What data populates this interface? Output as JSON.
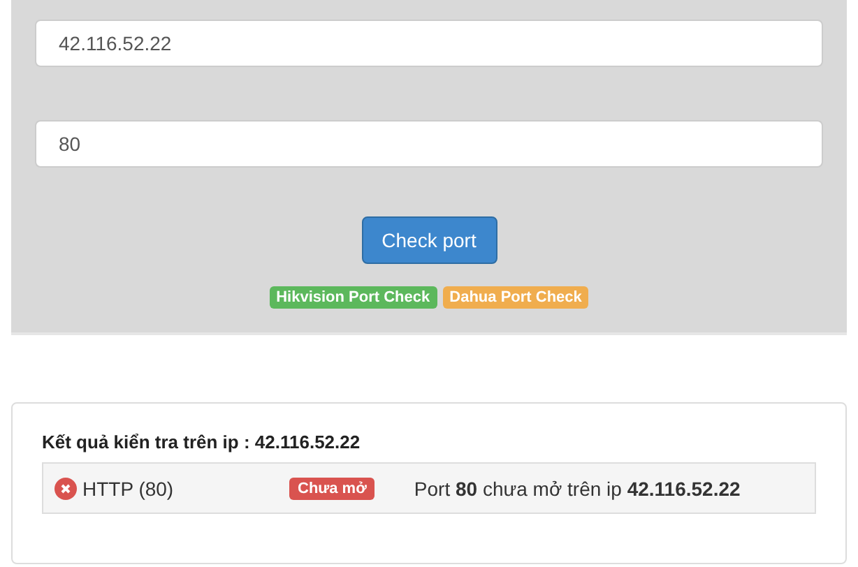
{
  "form": {
    "ip_field": {
      "value": "42.116.52.22"
    },
    "port_field": {
      "value": "80"
    },
    "submit": "Check port",
    "links": [
      {
        "label": "Hikvision Port Check",
        "color": "#5cb85c"
      },
      {
        "label": "Dahua Port Check",
        "color": "#f0ad4e"
      }
    ]
  },
  "result": {
    "title": "Kết quả kiển tra trên ip : 42.116.52.22",
    "rows": [
      {
        "service": "HTTP (80)",
        "open": false,
        "status": "Chưa mở",
        "message": "Port **80** chưa mở trên ip **42.116.52.22**"
      }
    ]
  }
}
